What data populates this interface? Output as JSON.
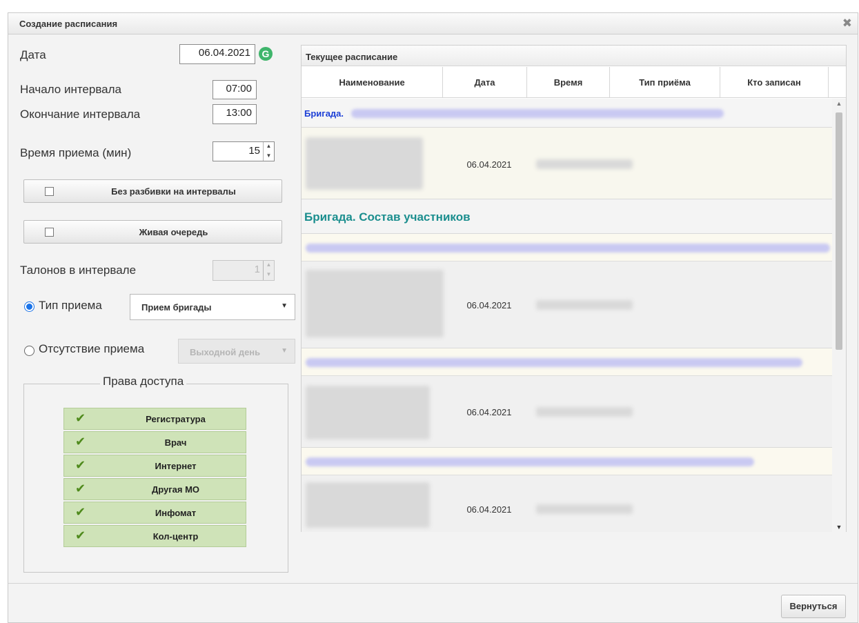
{
  "dialog": {
    "title": "Создание расписания",
    "close_icon": "close-icon"
  },
  "form": {
    "date_label": "Дата",
    "date_value": "06.04.2021",
    "refresh_icon": "refresh-icon",
    "refresh_glyph": "G",
    "interval_start_label": "Начало интервала",
    "interval_start_value": "07:00",
    "interval_end_label": "Окончание интервала",
    "interval_end_value": "13:00",
    "reception_time_label": "Время приема (мин)",
    "reception_time_value": "15",
    "no_intervals_label": "Без разбивки на интервалы",
    "no_intervals_checked": false,
    "live_queue_label": "Живая очередь",
    "live_queue_checked": false,
    "tickets_label": "Талонов в интервале",
    "tickets_value": "1",
    "reception_type_label": "Тип приема",
    "reception_type_selected": true,
    "reception_type_value": "Прием бригады",
    "absence_label": "Отсутствие приема",
    "absence_selected": false,
    "absence_value": "Выходной день"
  },
  "access": {
    "legend": "Права доступа",
    "check_icon": "checkmark-icon",
    "items": [
      "Регистратура",
      "Врач",
      "Интернет",
      "Другая МО",
      "Инфомат",
      "Кол-центр"
    ]
  },
  "schedule": {
    "title": "Текущее расписание",
    "columns": [
      "Наименование",
      "Дата",
      "Время",
      "Тип приёма",
      "Кто записан"
    ],
    "group_small_label": "Бригада.",
    "group_large_label": "Бригада. Состав участников",
    "row_dates": [
      "06.04.2021",
      "06.04.2021",
      "06.04.2021",
      "06.04.2021"
    ]
  },
  "footer": {
    "back_label": "Вернуться"
  },
  "colors": {
    "accent_blue": "#1c3fd6",
    "accent_teal": "#1b8e8e",
    "access_green": "#cfe3b8",
    "refresh_green": "#3fb56b"
  }
}
